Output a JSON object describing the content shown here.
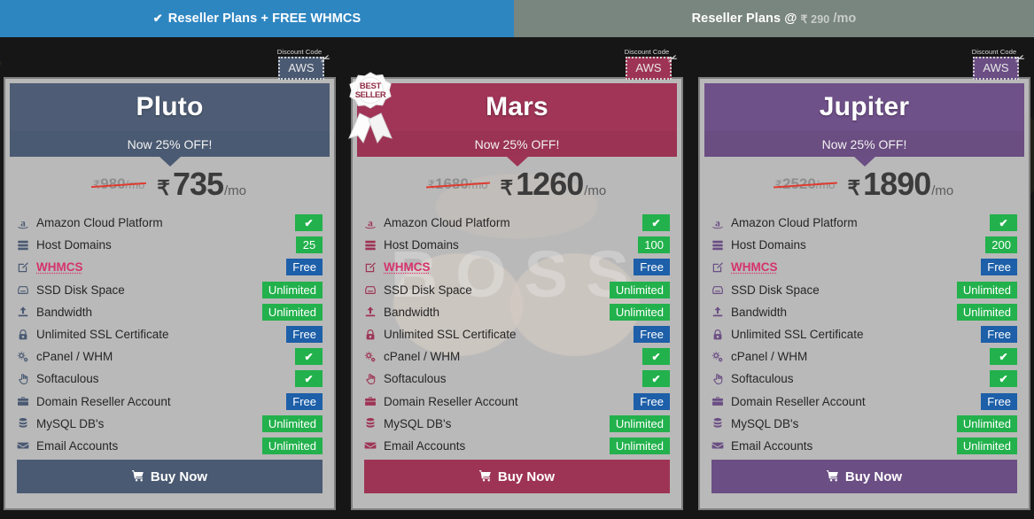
{
  "tabs": [
    {
      "label": "Reseller Plans + FREE WHMCS",
      "icon": "check-icon",
      "active": true,
      "color": "#2e86c1"
    },
    {
      "label": "Reseller Plans @",
      "price": "₹ 290",
      "period": "/mo",
      "active": false,
      "color": "#79857f"
    }
  ],
  "coupon": {
    "label": "Discount Code",
    "code": "AWS",
    "icon": "scissors-icon"
  },
  "badges": {
    "best_seller_line1": "BEST",
    "best_seller_line2": "SELLER"
  },
  "buy_label": "Buy Now",
  "buy_icon": "shopping-cart-icon",
  "discount_text": "Now 25% OFF!",
  "currency": "₹",
  "per_month": "/mo",
  "feature_icons": [
    "amazon-icon",
    "server-icon",
    "pencil-square-icon",
    "hdd-icon",
    "upload-icon",
    "lock-icon",
    "cogs-icon",
    "hand-pointer-icon",
    "briefcase-icon",
    "database-icon",
    "envelope-icon"
  ],
  "feature_labels": [
    "Amazon Cloud Platform",
    "Host Domains",
    "WHMCS",
    "SSD Disk Space",
    "Bandwidth",
    "Unlimited SSL Certificate",
    "cPanel / WHM",
    "Softaculous",
    "Domain Reseller Account",
    "MySQL DB's",
    "Email Accounts"
  ],
  "plans": [
    {
      "name": "Pluto",
      "accent": "#4a5a72",
      "header_color": "#4e5d75",
      "sub_color": "#4a5a72",
      "discount": "Now 25% OFF!",
      "old_price": "980",
      "new_price": "735",
      "best_seller": false,
      "values": [
        {
          "text": "✔",
          "type": "check"
        },
        {
          "text": "25",
          "type": "green"
        },
        {
          "text": "Free",
          "type": "blue"
        },
        {
          "text": "Unlimited",
          "type": "green"
        },
        {
          "text": "Unlimited",
          "type": "green"
        },
        {
          "text": "Free",
          "type": "blue"
        },
        {
          "text": "✔",
          "type": "check"
        },
        {
          "text": "✔",
          "type": "check"
        },
        {
          "text": "Free",
          "type": "blue"
        },
        {
          "text": "Unlimited",
          "type": "green"
        },
        {
          "text": "Unlimited",
          "type": "green"
        }
      ]
    },
    {
      "name": "Mars",
      "accent": "#9e3455",
      "header_color": "#a03558",
      "sub_color": "#9b3354",
      "discount": "Now 25% OFF!",
      "old_price": "1680",
      "new_price": "1260",
      "best_seller": true,
      "watermark": "BOSS",
      "values": [
        {
          "text": "✔",
          "type": "check"
        },
        {
          "text": "100",
          "type": "green"
        },
        {
          "text": "Free",
          "type": "blue"
        },
        {
          "text": "Unlimited",
          "type": "green"
        },
        {
          "text": "Unlimited",
          "type": "green"
        },
        {
          "text": "Free",
          "type": "blue"
        },
        {
          "text": "✔",
          "type": "check"
        },
        {
          "text": "✔",
          "type": "check"
        },
        {
          "text": "Free",
          "type": "blue"
        },
        {
          "text": "Unlimited",
          "type": "green"
        },
        {
          "text": "Unlimited",
          "type": "green"
        }
      ]
    },
    {
      "name": "Jupiter",
      "accent": "#6b4e84",
      "header_color": "#6f5189",
      "sub_color": "#6a4d81",
      "discount": "Now 25% OFF!",
      "old_price": "2520",
      "new_price": "1890",
      "best_seller": false,
      "values": [
        {
          "text": "✔",
          "type": "check"
        },
        {
          "text": "200",
          "type": "green"
        },
        {
          "text": "Free",
          "type": "blue"
        },
        {
          "text": "Unlimited",
          "type": "green"
        },
        {
          "text": "Unlimited",
          "type": "green"
        },
        {
          "text": "Free",
          "type": "blue"
        },
        {
          "text": "✔",
          "type": "check"
        },
        {
          "text": "✔",
          "type": "check"
        },
        {
          "text": "Free",
          "type": "blue"
        },
        {
          "text": "Unlimited",
          "type": "green"
        },
        {
          "text": "Unlimited",
          "type": "green"
        }
      ]
    }
  ]
}
